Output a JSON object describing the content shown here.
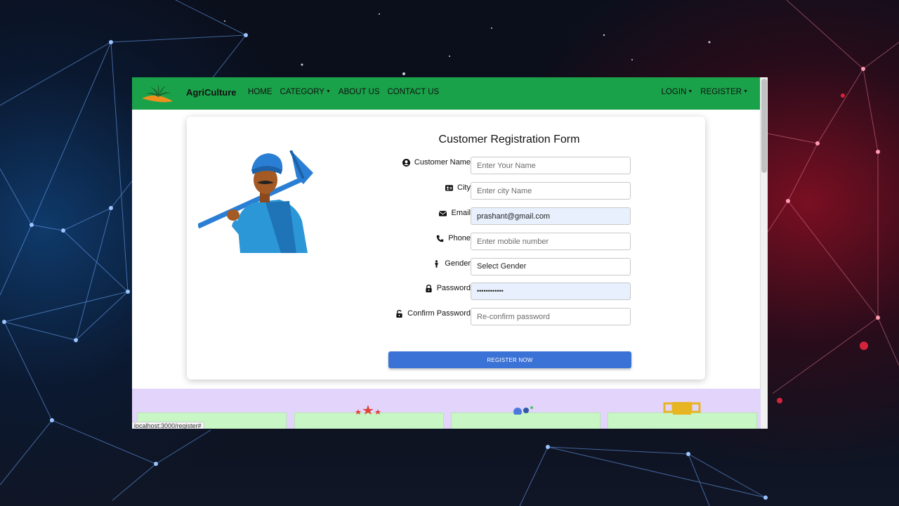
{
  "navbar": {
    "brand": "AgriCulture",
    "links": [
      {
        "label": "HOME"
      },
      {
        "label": "CATEGORY",
        "dropdown": true
      },
      {
        "label": "ABOUT US"
      },
      {
        "label": "CONTACT US"
      }
    ],
    "right_links": [
      {
        "label": "LOGIN",
        "dropdown": true
      },
      {
        "label": "REGISTER",
        "dropdown": true
      }
    ],
    "color": "#1aa24a"
  },
  "form": {
    "title": "Customer Registration Form",
    "fields": [
      {
        "label": "Customer Name",
        "icon": "user-circle-icon",
        "placeholder": "Enter Your Name",
        "value": ""
      },
      {
        "label": "City",
        "icon": "id-card-icon",
        "placeholder": "Enter city Name",
        "value": ""
      },
      {
        "label": "Email",
        "icon": "envelope-icon",
        "placeholder": "",
        "value": "prashant@gmail.com"
      },
      {
        "label": "Phone",
        "icon": "phone-icon",
        "placeholder": "Enter mobile number",
        "value": ""
      },
      {
        "label": "Gender",
        "icon": "person-icon",
        "placeholder": "",
        "value": "Select Gender"
      },
      {
        "label": "Password",
        "icon": "lock-icon",
        "placeholder": "",
        "value": "••••••••••••"
      },
      {
        "label": "Confirm Password",
        "icon": "unlock-icon",
        "placeholder": "Re-confirm password",
        "value": ""
      }
    ],
    "submit_label": "REGISTER NOW",
    "button_color": "#3b72d6"
  },
  "status_bar": {
    "url": "localhost:3000/register#"
  }
}
